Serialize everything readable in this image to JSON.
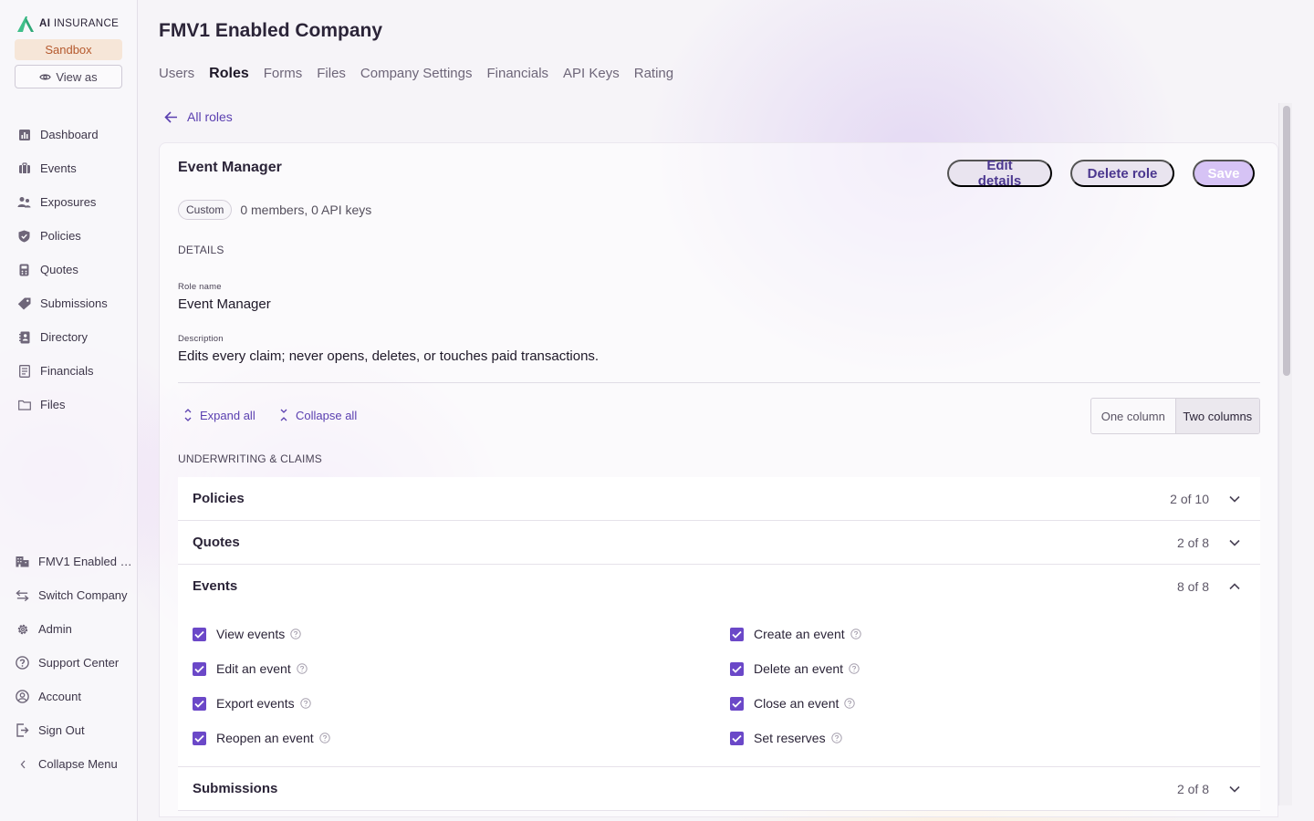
{
  "app": {
    "logo_text_strong": "AI",
    "logo_text": "INSURANCE",
    "environment": "Sandbox",
    "view_as_label": "View as",
    "accent_color": "#6b48c8"
  },
  "sidebar": {
    "items": [
      {
        "label": "Dashboard",
        "icon": "bar-chart-icon"
      },
      {
        "label": "Events",
        "icon": "briefcase-icon"
      },
      {
        "label": "Exposures",
        "icon": "people-icon"
      },
      {
        "label": "Policies",
        "icon": "shield-icon"
      },
      {
        "label": "Quotes",
        "icon": "calculator-icon"
      },
      {
        "label": "Submissions",
        "icon": "tag-icon"
      },
      {
        "label": "Directory",
        "icon": "address-book-icon"
      },
      {
        "label": "Financials",
        "icon": "ledger-icon"
      },
      {
        "label": "Files",
        "icon": "folder-icon"
      }
    ],
    "bottom": [
      {
        "label": "FMV1 Enabled Company",
        "icon": "building-icon"
      },
      {
        "label": "Switch Company",
        "icon": "switch-icon"
      },
      {
        "label": "Admin",
        "icon": "gear-icon"
      },
      {
        "label": "Support Center",
        "icon": "help-circle-icon"
      },
      {
        "label": "Account",
        "icon": "user-circle-icon"
      },
      {
        "label": "Sign Out",
        "icon": "sign-out-icon"
      },
      {
        "label": "Collapse Menu",
        "icon": "chevron-left-icon"
      }
    ]
  },
  "header": {
    "title": "FMV1 Enabled Company",
    "tabs": [
      "Users",
      "Roles",
      "Forms",
      "Files",
      "Company Settings",
      "Financials",
      "API Keys",
      "Rating"
    ],
    "active_tab": "Roles"
  },
  "back_link": "All roles",
  "role": {
    "name": "Event Manager",
    "edit_label": "Edit details",
    "delete_label": "Delete role",
    "save_label": "Save",
    "type_badge": "Custom",
    "member_summary": "0 members, 0 API keys",
    "details_heading": "DETAILS",
    "role_name_label": "Role name",
    "role_name_value": "Event Manager",
    "description_label": "Description",
    "description_value": "Edits every claim; never opens, deletes, or touches paid transactions."
  },
  "controls": {
    "expand_all": "Expand all",
    "collapse_all": "Collapse all",
    "one_column": "One column",
    "two_columns": "Two columns",
    "selected_layout": "Two columns"
  },
  "section_heading": "UNDERWRITING & CLAIMS",
  "groups": [
    {
      "name": "Policies",
      "count": "2 of 10",
      "expanded": false
    },
    {
      "name": "Quotes",
      "count": "2 of 8",
      "expanded": false
    },
    {
      "name": "Events",
      "count": "8 of 8",
      "expanded": true,
      "permissions": [
        {
          "label": "View events",
          "checked": true
        },
        {
          "label": "Create an event",
          "checked": true
        },
        {
          "label": "Edit an event",
          "checked": true
        },
        {
          "label": "Delete an event",
          "checked": true
        },
        {
          "label": "Export events",
          "checked": true
        },
        {
          "label": "Close an event",
          "checked": true
        },
        {
          "label": "Reopen an event",
          "checked": true
        },
        {
          "label": "Set reserves",
          "checked": true
        }
      ]
    },
    {
      "name": "Submissions",
      "count": "2 of 8",
      "expanded": false
    }
  ]
}
